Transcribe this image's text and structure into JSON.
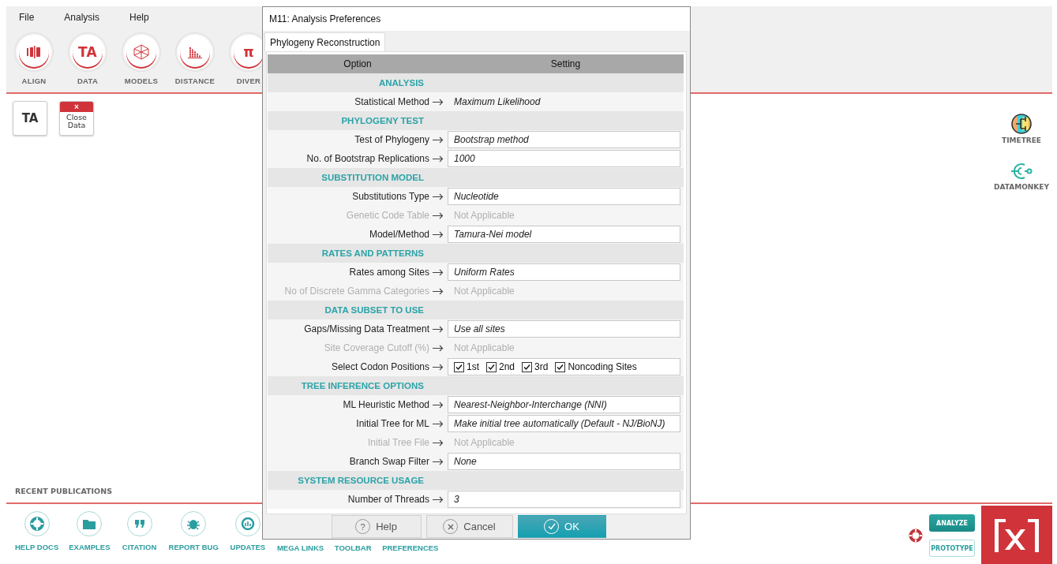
{
  "menu": [
    {
      "label": "File"
    },
    {
      "label": "Analysis"
    },
    {
      "label": "Help"
    }
  ],
  "toolbar": [
    {
      "label": "ALIGN",
      "kind": "align"
    },
    {
      "label": "DATA",
      "kind": "glyph",
      "glyph": "TA"
    },
    {
      "label": "MODELS",
      "kind": "models"
    },
    {
      "label": "DISTANCE",
      "kind": "distance"
    },
    {
      "label": "DIVER",
      "kind": "glyph",
      "glyph": "π"
    }
  ],
  "quick_buttons": [
    {
      "kind": "glyph",
      "glyph": "TA"
    },
    {
      "kind": "close",
      "mark": "×",
      "label": "Close Data"
    }
  ],
  "services": [
    {
      "label": "TIMETREE",
      "kind": "timetree"
    },
    {
      "label": "DATAMONKEY",
      "kind": "datamonkey"
    }
  ],
  "recent_publications": {
    "title": "RECENT PUBLICATIONS"
  },
  "bottom_bar": [
    {
      "label": "HELP DOCS",
      "kind": "lifebuoy",
      "covered": false
    },
    {
      "label": "EXAMPLES",
      "kind": "folder",
      "covered": false
    },
    {
      "label": "CITATION",
      "kind": "quote",
      "covered": false
    },
    {
      "label": "REPORT BUG",
      "kind": "bug",
      "covered": false
    },
    {
      "label": "UPDATES",
      "kind": "updates",
      "covered": false
    },
    {
      "label": "MEGA LINKS",
      "covered": true
    },
    {
      "label": "TOOLBAR",
      "covered": true
    },
    {
      "label": "PREFERENCES",
      "covered": true
    }
  ],
  "mode_buttons": [
    {
      "label": "ANALYZE",
      "selected": true
    },
    {
      "label": "PROTOTYPE",
      "selected": false
    }
  ],
  "dialog": {
    "title": "M11: Analysis Preferences",
    "tabs": [
      {
        "label": "Phylogeny Reconstruction",
        "selected": true
      }
    ],
    "columns": [
      "Option",
      "Setting"
    ],
    "rows": [
      {
        "kind": "section",
        "label": "ANALYSIS"
      },
      {
        "kind": "option",
        "label": "Statistical Method",
        "value": "Maximum Likelihood",
        "editable": false,
        "disabled": false
      },
      {
        "kind": "section",
        "label": "PHYLOGENY TEST"
      },
      {
        "kind": "option",
        "label": "Test of Phylogeny",
        "value": "Bootstrap method",
        "editable": true,
        "disabled": false
      },
      {
        "kind": "option",
        "label": "No. of Bootstrap Replications",
        "value": "1000",
        "editable": true,
        "disabled": false
      },
      {
        "kind": "section",
        "label": "SUBSTITUTION MODEL"
      },
      {
        "kind": "option",
        "label": "Substitutions Type",
        "value": "Nucleotide",
        "editable": true,
        "disabled": false
      },
      {
        "kind": "option",
        "label": "Genetic Code Table",
        "value": "Not Applicable",
        "editable": false,
        "disabled": true
      },
      {
        "kind": "option",
        "label": "Model/Method",
        "value": "Tamura-Nei model",
        "editable": true,
        "disabled": false
      },
      {
        "kind": "section",
        "label": "RATES AND PATTERNS"
      },
      {
        "kind": "option",
        "label": "Rates among Sites",
        "value": "Uniform Rates",
        "editable": true,
        "disabled": false
      },
      {
        "kind": "option",
        "label": "No of Discrete Gamma Categories",
        "value": "Not Applicable",
        "editable": false,
        "disabled": true
      },
      {
        "kind": "section",
        "label": "DATA SUBSET TO USE"
      },
      {
        "kind": "option",
        "label": "Gaps/Missing Data Treatment",
        "value": "Use all sites",
        "editable": true,
        "disabled": false
      },
      {
        "kind": "option",
        "label": "Site Coverage Cutoff (%)",
        "value": "Not Applicable",
        "editable": false,
        "disabled": true
      },
      {
        "kind": "checks",
        "label": "Select Codon Positions",
        "options": [
          {
            "label": "1st",
            "checked": true
          },
          {
            "label": "2nd",
            "checked": true
          },
          {
            "label": "3rd",
            "checked": true
          },
          {
            "label": "Noncoding Sites",
            "checked": true
          }
        ]
      },
      {
        "kind": "section",
        "label": "TREE INFERENCE OPTIONS"
      },
      {
        "kind": "option",
        "label": "ML Heuristic Method",
        "value": "Nearest-Neighbor-Interchange (NNI)",
        "editable": true,
        "disabled": false
      },
      {
        "kind": "option",
        "label": "Initial Tree for ML",
        "value": "Make initial tree automatically (Default - NJ/BioNJ)",
        "editable": true,
        "disabled": false
      },
      {
        "kind": "option",
        "label": "Initial Tree File",
        "value": "Not Applicable",
        "editable": false,
        "disabled": true
      },
      {
        "kind": "option",
        "label": "Branch Swap Filter",
        "value": "None",
        "editable": true,
        "disabled": false
      },
      {
        "kind": "section",
        "label": "SYSTEM RESOURCE USAGE"
      },
      {
        "kind": "option",
        "label": "Number of Threads",
        "value": "3",
        "editable": true,
        "disabled": false
      }
    ],
    "buttons": [
      {
        "label": "Help",
        "kind": "help",
        "icon": "?"
      },
      {
        "label": "Cancel",
        "kind": "cancel"
      },
      {
        "label": "OK",
        "kind": "ok"
      }
    ]
  }
}
